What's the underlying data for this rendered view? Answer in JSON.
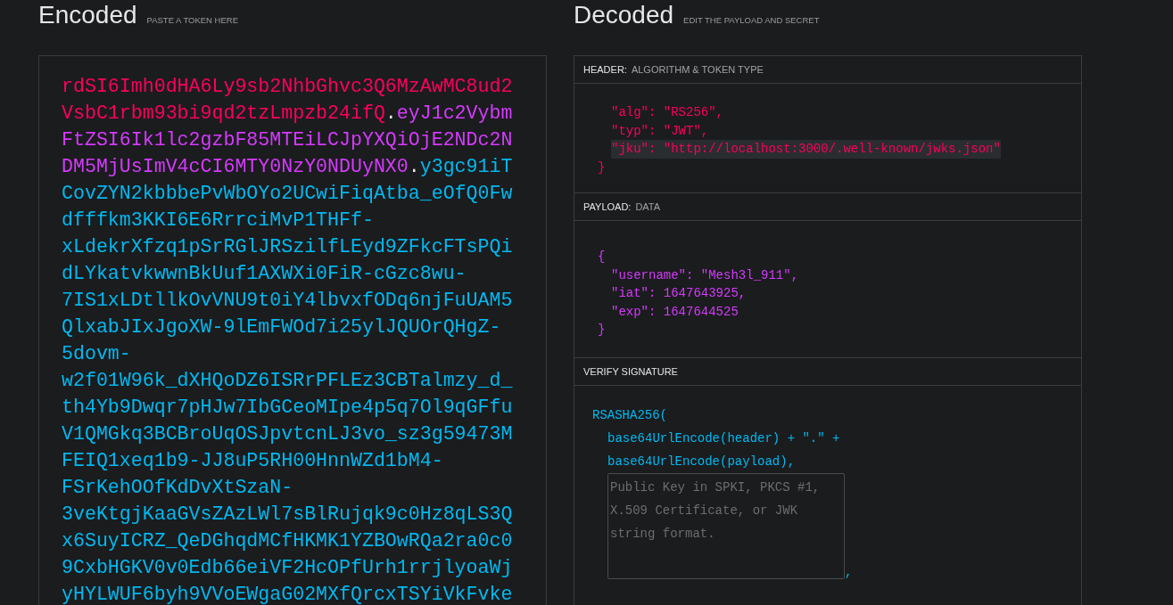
{
  "encoded": {
    "title": "Encoded",
    "hint": "PASTE A TOKEN HERE",
    "lines": [
      [
        {
          "text": "rdSI6Imh0dHA6Ly9sb2NhbGhvc3Q6MzAwMC8ud2",
          "kind": "header"
        }
      ],
      [
        {
          "text": "VsbC1rbm93bi9qd2tzLmpzb24ifQ",
          "kind": "header"
        },
        {
          "text": ".",
          "kind": "dot"
        },
        {
          "text": "eyJ1c2Vybm",
          "kind": "payload"
        }
      ],
      [
        {
          "text": "FtZSI6Ik1lc2gzbF85MTEiLCJpYXQiOjE2NDc2N",
          "kind": "payload"
        }
      ],
      [
        {
          "text": "DM5MjUsImV4cCI6MTY0NzY0NDUyNX0",
          "kind": "payload"
        },
        {
          "text": ".",
          "kind": "dot"
        },
        {
          "text": "y3gc91iT",
          "kind": "signature"
        }
      ],
      [
        {
          "text": "CovZYN2kbbbePvWbOYo2UCwiFiqAtba_eOfQ0Fw",
          "kind": "signature"
        }
      ],
      [
        {
          "text": "dfffkm3KKI6E6RrrciMvP1THFf-",
          "kind": "signature"
        }
      ],
      [
        {
          "text": "xLdekrXfzq1pSrRGlJRSzilfLEyd9ZFkcFTsPQi",
          "kind": "signature"
        }
      ],
      [
        {
          "text": "dLYkatvkwwnBkUuf1AXWXi0FiR-cGzc8wu-",
          "kind": "signature"
        }
      ],
      [
        {
          "text": "7IS1xLDtllkOvVNU9t0iY4lbvxfODq6njFuUAM5",
          "kind": "signature"
        }
      ],
      [
        {
          "text": "QlxabJIxJgoXW-9lEmFWOd7i25ylJQUOrQHgZ-",
          "kind": "signature"
        }
      ],
      [
        {
          "text": "5dovm-",
          "kind": "signature"
        }
      ],
      [
        {
          "text": "w2f01W96k_dXHQoDZ6ISRrPFLEz3CBTalmzy_d_",
          "kind": "signature"
        }
      ],
      [
        {
          "text": "th4Yb9Dwqr7pHJw7IbGCeoMIpe4p5q7Ol9qGFfu",
          "kind": "signature"
        }
      ],
      [
        {
          "text": "V1QMGkq3BCBroUqOSJpvtcnLJ3vo_sz3g59473M",
          "kind": "signature"
        }
      ],
      [
        {
          "text": "FEIQ1xeq1b9-JJ8uP5RH00HnnWZd1bM4-",
          "kind": "signature"
        }
      ],
      [
        {
          "text": "FSrKehOOfKdDvXtSzaN-",
          "kind": "signature"
        }
      ],
      [
        {
          "text": "3veKtgjKaaGVsZAzLWl7sBlRujqk9c0Hz8qLS3Q",
          "kind": "signature"
        }
      ],
      [
        {
          "text": "x6SuyICRZ_QeDGhqdMCfHKMK1YZBOwRQa2ra0c0",
          "kind": "signature"
        }
      ],
      [
        {
          "text": "9CxbHGKV0v0Edb66eiVF2HcOPfUrh1rrjlyoaWj",
          "kind": "signature"
        }
      ],
      [
        {
          "text": "yHYLWUF6byh9VVoEWgaG02MXfQrcxTSYiVkFvke",
          "kind": "signature"
        }
      ]
    ]
  },
  "decoded": {
    "title": "Decoded",
    "hint": "EDIT THE PAYLOAD AND SECRET",
    "sections": [
      {
        "kind": "header",
        "label": "HEADER:",
        "sublabel": "ALGORITHM & TOKEN TYPE",
        "lines": [
          {
            "text": "\"alg\": \"RS256\",",
            "kind": "member",
            "highlighted": false
          },
          {
            "text": "\"typ\": \"JWT\",",
            "kind": "member",
            "highlighted": false
          },
          {
            "text": "\"jku\": \"http://localhost:3000/.well-known/jwks.json\"",
            "kind": "member",
            "highlighted": true
          },
          {
            "text": "}",
            "kind": "brace",
            "highlighted": false
          }
        ]
      },
      {
        "kind": "payload",
        "label": "PAYLOAD:",
        "sublabel": "DATA",
        "lines": [
          {
            "text": "{",
            "kind": "brace",
            "highlighted": false
          },
          {
            "text": "\"username\": \"Mesh3l_911\",",
            "kind": "member",
            "highlighted": false
          },
          {
            "text": "\"iat\": 1647643925,",
            "kind": "member",
            "highlighted": false
          },
          {
            "text": "\"exp\": 1647644525",
            "kind": "member",
            "highlighted": false
          },
          {
            "text": "}",
            "kind": "brace",
            "highlighted": false
          }
        ]
      },
      {
        "kind": "signature",
        "label": "VERIFY SIGNATURE",
        "lines": [
          {
            "text": "RSASHA256(",
            "kind": "brace",
            "highlighted": false
          },
          {
            "text": "base64UrlEncode(header) + \".\" +",
            "kind": "member",
            "highlighted": false
          },
          {
            "text": "base64UrlEncode(payload),",
            "kind": "member",
            "highlighted": false
          }
        ],
        "key_field": {
          "placeholder": "Public Key in SPKI, PKCS #1, X.509 Certificate, or JWK string format."
        },
        "after_field": ","
      }
    ]
  }
}
